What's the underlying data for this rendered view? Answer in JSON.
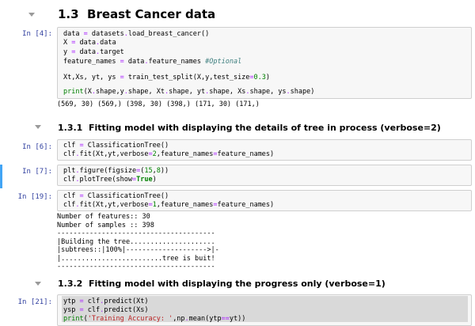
{
  "heading_main": "1.3  Breast Cancer data",
  "heading_verbose2": "1.3.1  Fitting model with displaying the details of tree in process (verbose=2)",
  "heading_verbose1": "1.3.2  Fitting model with displaying the progress only (verbose=1)",
  "cells": [
    {
      "prompt": "In [4]:",
      "code": [
        "data = datasets.load_breast_cancer()",
        "X = data.data",
        "y = data.target",
        "",
        "feature_names = data.feature_names #Optional",
        "",
        "Xt,Xs, yt, ys = train_test_split(X,y,test_size=0.3)",
        "",
        "print(X.shape,y.shape, Xt.shape, yt.shape, Xs.shape, ys.shape)"
      ],
      "output": [
        "(569, 30) (569,) (398, 30) (398,) (171, 30) (171,)"
      ]
    },
    {
      "prompt": "In [6]:",
      "code": [
        "clf = ClassificationTree()",
        "clf.fit(Xt,yt,verbose=2,feature_names=feature_names)"
      ]
    },
    {
      "prompt": "In [7]:",
      "code": [
        "plt.figure(figsize=(15,8))",
        "clf.plotTree(show=True)"
      ]
    },
    {
      "prompt": "In [19]:",
      "code": [
        "clf = ClassificationTree()",
        "clf.fit(Xt,yt,verbose=1,feature_names=feature_names)"
      ],
      "output": [
        "Number of features:: 30",
        "Number of samples :: 398",
        "---------------------------------------",
        "|Building the tree.....................",
        "|subtrees::|100%|-------------------->|-",
        "|.........................tree is buit!",
        "---------------------------------------"
      ]
    },
    {
      "prompt": "In [21]:",
      "code": [
        "ytp = clf.predict(Xt)",
        "ysp = clf.predict(Xs)",
        "print('Training Accuracy: ',np.mean(ytp==yt))"
      ]
    }
  ],
  "colors": {
    "prompt": "#303f9f",
    "cell_bg": "#f7f7f7",
    "selected_bar": "#42a5f5",
    "keyword": "#008000",
    "operator": "#aa22ff",
    "string": "#ba2121",
    "comment": "#408080"
  }
}
